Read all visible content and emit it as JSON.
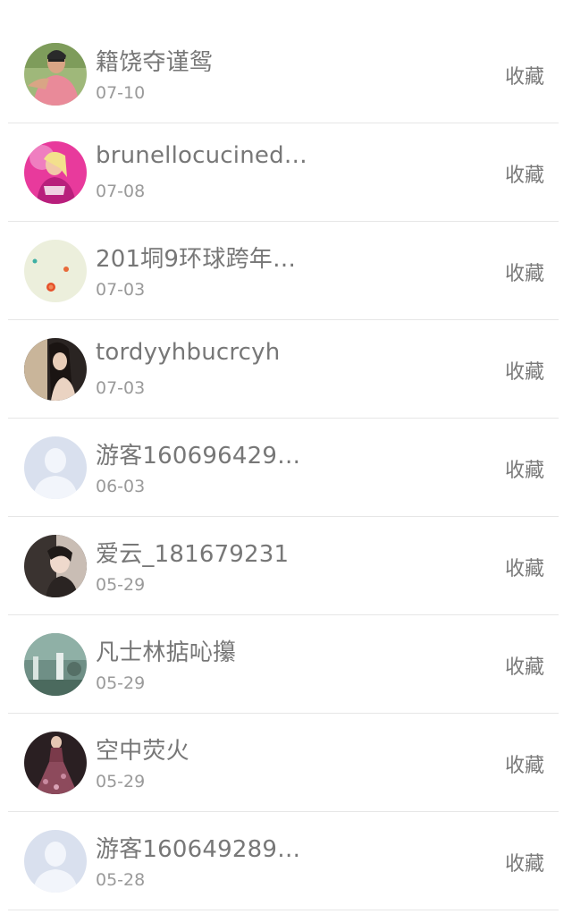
{
  "favorites": {
    "items": [
      {
        "name": "籍饶夺谨鸳",
        "date": "07-10",
        "action": "收藏",
        "avatar_icon": "user-photo-man-pink-shirt"
      },
      {
        "name": "brunellocucined…",
        "date": "07-08",
        "action": "收藏",
        "avatar_icon": "user-photo-woman-pink"
      },
      {
        "name": "201垌9环球跨年…",
        "date": "07-03",
        "action": "收藏",
        "avatar_icon": "user-photo-dots"
      },
      {
        "name": "tordyyhbucrcyh",
        "date": "07-03",
        "action": "收藏",
        "avatar_icon": "user-photo-woman-dark"
      },
      {
        "name": "游客160696429…",
        "date": "06-03",
        "action": "收藏",
        "avatar_icon": "default-avatar-icon"
      },
      {
        "name": "爱云_181679231",
        "date": "05-29",
        "action": "收藏",
        "avatar_icon": "user-photo-woman-portrait"
      },
      {
        "name": "凡士林掂吣攥",
        "date": "05-29",
        "action": "收藏",
        "avatar_icon": "user-photo-landscape"
      },
      {
        "name": "空中荧火",
        "date": "05-29",
        "action": "收藏",
        "avatar_icon": "user-photo-woman-dress"
      },
      {
        "name": "游客160649289…",
        "date": "05-28",
        "action": "收藏",
        "avatar_icon": "default-avatar-icon"
      }
    ]
  },
  "colors": {
    "name_text": "#777777",
    "date_text": "#9a9a9a",
    "divider": "#e6e6e6",
    "default_avatar_bg": "#d9e0ee"
  }
}
